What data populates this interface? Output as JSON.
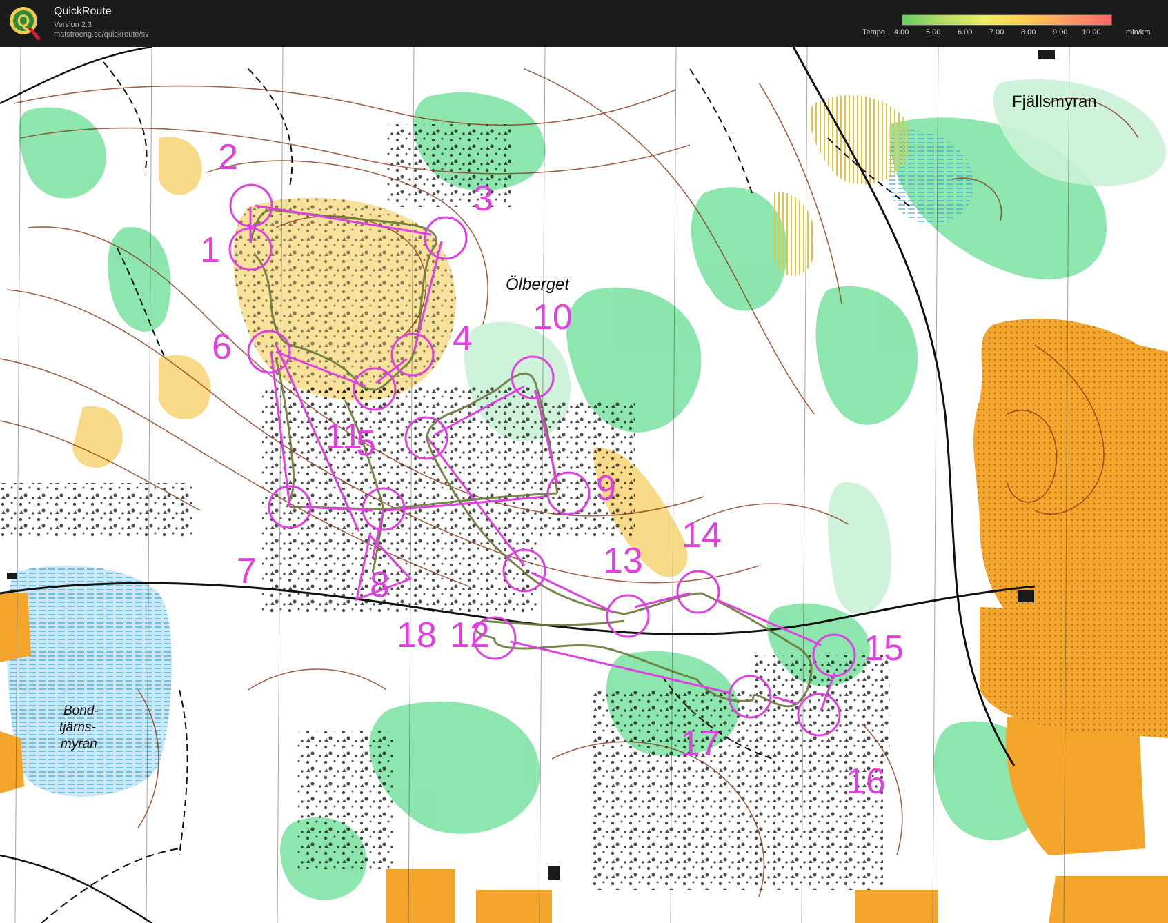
{
  "app": {
    "title": "QuickRoute",
    "version": "Version 2.3",
    "url": "matstroeng.se/quickroute/sv",
    "logo_letter": "Q"
  },
  "tempo": {
    "label": "Tempo",
    "ticks": [
      "4.00",
      "5.00",
      "6.00",
      "7.00",
      "8.00",
      "9.00",
      "10.00"
    ],
    "unit": "min/km",
    "gradient_colors": [
      "#66cc66",
      "#b8dd66",
      "#eeee66",
      "#ffcc55",
      "#ff9966",
      "#ff6666"
    ]
  },
  "map": {
    "place_names": [
      "Ölberget",
      "Fjällsmyran",
      "Bond-",
      "tjärns-",
      "myran"
    ],
    "control_labels": [
      "1",
      "2",
      "3",
      "4",
      "5",
      "6",
      "7",
      "8",
      "9",
      "10",
      "11",
      "12",
      "13",
      "14",
      "15",
      "16",
      "17",
      "18"
    ],
    "colors": {
      "course": "#e040e0",
      "route": "#6a7a3a",
      "open_land": "#f3a52c",
      "forest_green": "#5fdc8c",
      "contour": "#8a3a1a",
      "marsh": "#c9e8f4",
      "rough_open": "#f5cf6a"
    }
  }
}
